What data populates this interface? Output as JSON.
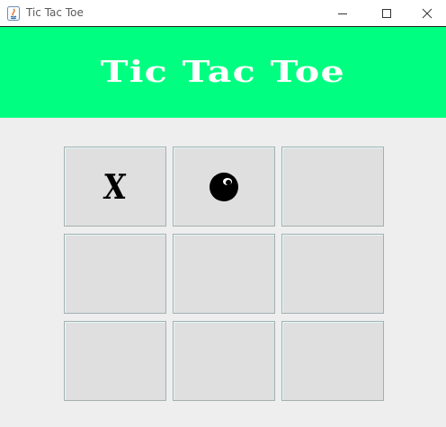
{
  "window": {
    "title": "Tic Tac Toe",
    "controls": [
      "minimize-icon",
      "maximize-icon",
      "close-icon"
    ]
  },
  "header": {
    "title": "Tic Tac Toe",
    "background": "#00ff80",
    "text_color": "#ffffff"
  },
  "board": {
    "rows": 3,
    "cols": 3,
    "cells": [
      {
        "mark": "X"
      },
      {
        "mark": "O"
      },
      {
        "mark": ""
      },
      {
        "mark": ""
      },
      {
        "mark": ""
      },
      {
        "mark": ""
      },
      {
        "mark": ""
      },
      {
        "mark": ""
      },
      {
        "mark": ""
      }
    ]
  }
}
